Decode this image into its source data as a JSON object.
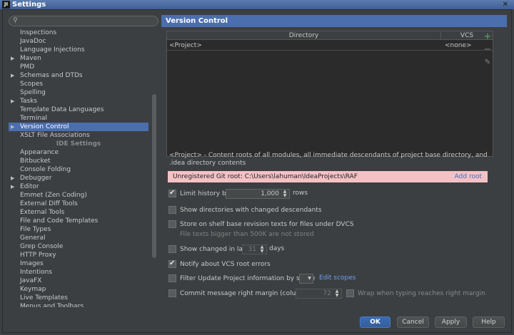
{
  "window": {
    "icon": "JI",
    "title": "Settings",
    "close": "✕"
  },
  "search": {
    "placeholder": ""
  },
  "tree": {
    "items": [
      {
        "label": "Inspections",
        "arrow": false
      },
      {
        "label": "JavaDoc",
        "arrow": false
      },
      {
        "label": "Language Injections",
        "arrow": false
      },
      {
        "label": "Maven",
        "arrow": true
      },
      {
        "label": "PMD",
        "arrow": false
      },
      {
        "label": "Schemas and DTDs",
        "arrow": true
      },
      {
        "label": "Scopes",
        "arrow": false
      },
      {
        "label": "Spelling",
        "arrow": false
      },
      {
        "label": "Tasks",
        "arrow": true
      },
      {
        "label": "Template Data Languages",
        "arrow": false
      },
      {
        "label": "Terminal",
        "arrow": false
      },
      {
        "label": "Version Control",
        "arrow": true,
        "selected": true
      },
      {
        "label": "XSLT File Associations",
        "arrow": false
      }
    ],
    "section": "IDE Settings",
    "ide_items": [
      {
        "label": "Appearance",
        "arrow": false
      },
      {
        "label": "Bitbucket",
        "arrow": false
      },
      {
        "label": "Console Folding",
        "arrow": false
      },
      {
        "label": "Debugger",
        "arrow": true
      },
      {
        "label": "Editor",
        "arrow": true
      },
      {
        "label": "Emmet (Zen Coding)",
        "arrow": false
      },
      {
        "label": "External Diff Tools",
        "arrow": false
      },
      {
        "label": "External Tools",
        "arrow": false
      },
      {
        "label": "File and Code Templates",
        "arrow": false
      },
      {
        "label": "File Types",
        "arrow": false
      },
      {
        "label": "General",
        "arrow": false
      },
      {
        "label": "Grep Console",
        "arrow": false
      },
      {
        "label": "HTTP Proxy",
        "arrow": false
      },
      {
        "label": "Images",
        "arrow": false
      },
      {
        "label": "Intentions",
        "arrow": false
      },
      {
        "label": "JavaFX",
        "arrow": false
      },
      {
        "label": "Keymap",
        "arrow": false
      },
      {
        "label": "Live Templates",
        "arrow": false
      },
      {
        "label": "Menus and Toolbars",
        "arrow": false
      }
    ]
  },
  "panel": {
    "title": "Version Control",
    "table": {
      "headers": {
        "directory": "Directory",
        "vcs": "VCS"
      },
      "rows": [
        {
          "directory": "<Project>",
          "vcs": "<none>"
        }
      ]
    },
    "tools": {
      "add": "+",
      "remove": "−",
      "edit": "✎"
    },
    "roots_description": "<Project> - Content roots of all modules, all immediate descendants of project base directory, and .idea directory contents",
    "warning": {
      "text": "Unregistered Git root: C:\\Users\\lahuman\\IdeaProjects\\RAF",
      "action": "Add root"
    },
    "options": {
      "limit_history": {
        "label": "Limit history by:",
        "checked": true,
        "value": "1,000",
        "unit": "rows"
      },
      "show_dirs": {
        "label": "Show directories with changed descendants",
        "checked": false
      },
      "shelve": {
        "label": "Store on shelf base revision texts for files under DVCS",
        "checked": false,
        "note": "File texts bigger than 500K are not stored"
      },
      "show_changed": {
        "label": "Show changed in last",
        "checked": false,
        "value": "31",
        "unit": "days"
      },
      "notify": {
        "label": "Notify about VCS root errors",
        "checked": true
      },
      "filter_update": {
        "label": "Filter Update Project information by scope",
        "checked": false,
        "link": "Edit scopes"
      },
      "commit_margin": {
        "label": "Commit message right margin (columns):",
        "checked": false,
        "value": "72",
        "wrap_label": "Wrap when typing reaches right margin",
        "wrap_checked": false
      }
    }
  },
  "buttons": {
    "ok": "OK",
    "cancel": "Cancel",
    "apply": "Apply",
    "help": "Help"
  }
}
